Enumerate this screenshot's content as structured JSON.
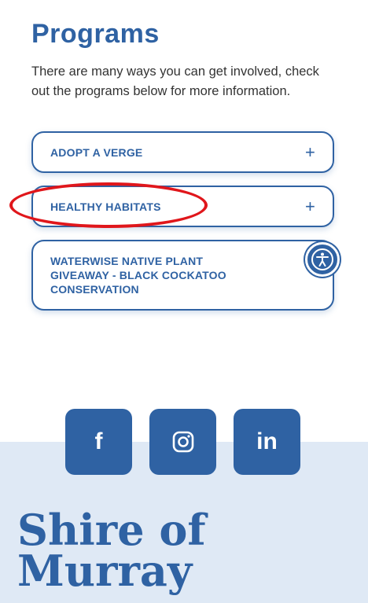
{
  "programs_section": {
    "heading": "Programs",
    "intro": "There are many ways you can get involved, check out the programs below for more information."
  },
  "programs": [
    {
      "label": "ADOPT A VERGE",
      "expand_icon": "+"
    },
    {
      "label": "HEALTHY HABITATS",
      "expand_icon": "+"
    },
    {
      "label_lines": [
        "WATERWISE NATIVE PLANT",
        "GIVEAWAY - BLACK COCKATOO",
        "CONSERVATION"
      ]
    }
  ],
  "social": {
    "facebook": "f",
    "linkedin": "in"
  },
  "footer": {
    "brand_line1": "Shire of",
    "brand_line2": "Murray"
  },
  "colors": {
    "primary": "#2f62a3",
    "footer_bg": "#dfe9f5",
    "highlight": "#e0161b"
  }
}
